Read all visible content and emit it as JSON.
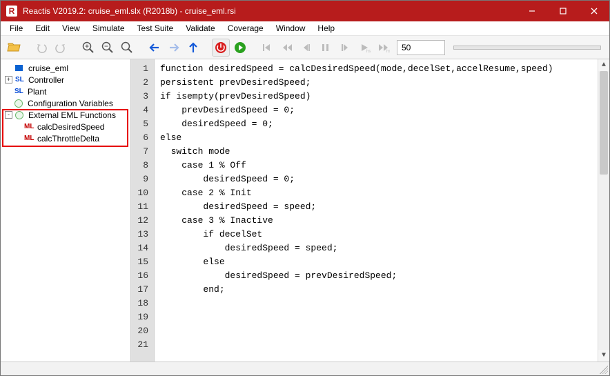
{
  "title": "Reactis V2019.2: cruise_eml.slx (R2018b) - cruise_eml.rsi",
  "app_icon_letter": "R",
  "menus": [
    "File",
    "Edit",
    "View",
    "Simulate",
    "Test Suite",
    "Validate",
    "Coverage",
    "Window",
    "Help"
  ],
  "toolbar": {
    "step_input": "50"
  },
  "tree": {
    "root": "cruise_eml",
    "items": [
      {
        "icon": "SL",
        "label": "Controller",
        "exp": "+"
      },
      {
        "icon": "SL",
        "label": "Plant",
        "exp": " "
      },
      {
        "icon": "circ",
        "label": "Configuration Variables",
        "exp": " "
      },
      {
        "icon": "circ",
        "label": "External EML Functions",
        "exp": "-"
      }
    ],
    "eml_children": [
      {
        "icon": "ML",
        "label": "calcDesiredSpeed"
      },
      {
        "icon": "ML",
        "label": "calcThrottleDelta"
      }
    ]
  },
  "code_lines": [
    "",
    "function desiredSpeed = calcDesiredSpeed(mode,decelSet,accelResume,speed)",
    "",
    "persistent prevDesiredSpeed;",
    "",
    "if isempty(prevDesiredSpeed)",
    "    prevDesiredSpeed = 0;",
    "    desiredSpeed = 0;",
    "else",
    "",
    "  switch mode",
    "    case 1 % Off",
    "        desiredSpeed = 0;",
    "    case 2 % Init",
    "        desiredSpeed = speed;",
    "    case 3 % Inactive",
    "        if decelSet",
    "            desiredSpeed = speed;",
    "        else",
    "            desiredSpeed = prevDesiredSpeed;",
    "        end;"
  ]
}
